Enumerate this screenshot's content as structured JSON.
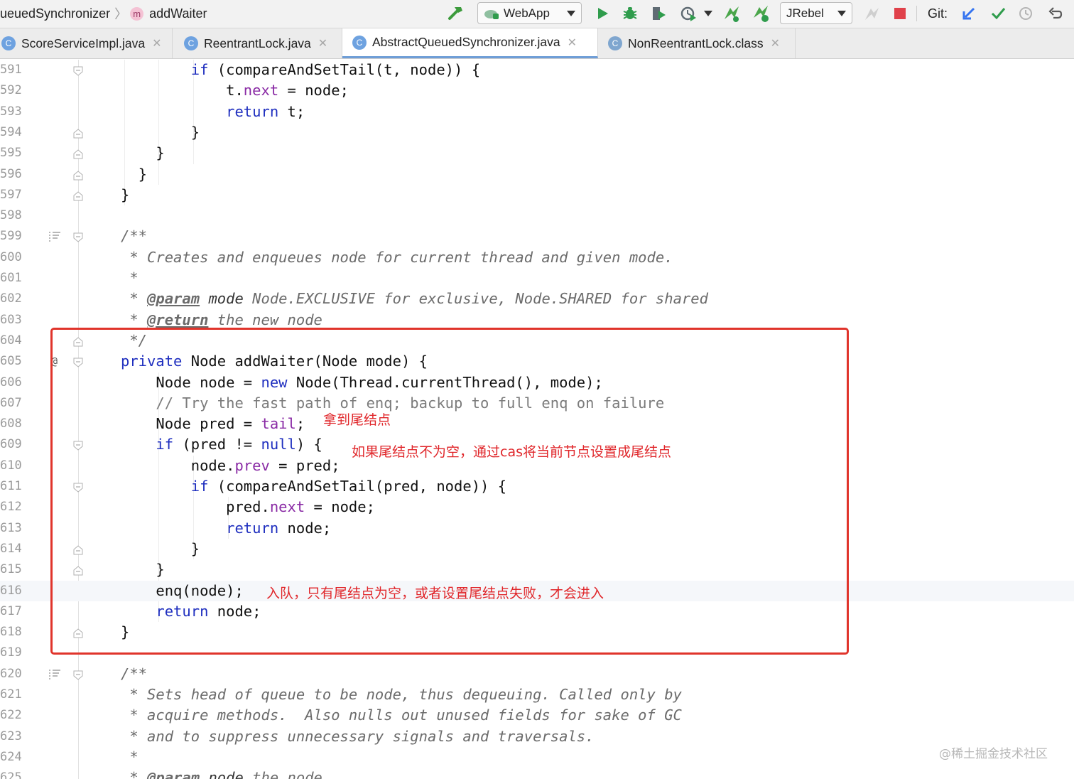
{
  "breadcrumb": {
    "class_name": "ueuedSynchronizer",
    "separator": "〉",
    "method_badge": "m",
    "method_name": "addWaiter"
  },
  "toolbar": {
    "run_config": "WebApp",
    "jrebel_config": "JRebel",
    "git_label": "Git:"
  },
  "tabs": [
    {
      "label": "ScoreServiceImpl.java",
      "badge": "C",
      "active": false
    },
    {
      "label": "ReentrantLock.java",
      "badge": "C",
      "active": false
    },
    {
      "label": "AbstractQueuedSynchronizer.java",
      "badge": "C",
      "active": true
    },
    {
      "label": "NonReentrantLock.class",
      "badge": "C",
      "active": false
    }
  ],
  "editor": {
    "gutter_marker_605": "@",
    "lines": [
      {
        "n": "591",
        "tokens": [
          [
            "",
            "        "
          ],
          [
            "kw",
            "if"
          ],
          [
            "",
            " (compareAndSetTail(t, node)) {"
          ]
        ]
      },
      {
        "n": "592",
        "tokens": [
          [
            "",
            "            t."
          ],
          [
            "fld",
            "next"
          ],
          [
            "",
            " = node;"
          ]
        ]
      },
      {
        "n": "593",
        "tokens": [
          [
            "",
            "            "
          ],
          [
            "kw",
            "return"
          ],
          [
            "",
            " t;"
          ]
        ]
      },
      {
        "n": "594",
        "tokens": [
          [
            "",
            "        }"
          ]
        ]
      },
      {
        "n": "595",
        "tokens": [
          [
            "",
            "    }"
          ]
        ]
      },
      {
        "n": "596",
        "tokens": [
          [
            "",
            "  }"
          ]
        ]
      },
      {
        "n": "597",
        "tokens": [
          [
            "",
            "}"
          ]
        ]
      },
      {
        "n": "598",
        "tokens": []
      },
      {
        "n": "599",
        "tokens": [
          [
            "doc",
            "/**"
          ]
        ]
      },
      {
        "n": "600",
        "tokens": [
          [
            "doc",
            " * Creates and enqueues node for current thread and given mode."
          ]
        ]
      },
      {
        "n": "601",
        "tokens": [
          [
            "doc",
            " *"
          ]
        ]
      },
      {
        "n": "602",
        "tokens": [
          [
            "doc",
            " * "
          ],
          [
            "tag",
            "@param"
          ],
          [
            "doc",
            " "
          ],
          [
            "docb",
            "mode"
          ],
          [
            "doc",
            " Node.EXCLUSIVE for exclusive, Node.SHARED for shared"
          ]
        ]
      },
      {
        "n": "603",
        "tokens": [
          [
            "doc",
            " * "
          ],
          [
            "tag",
            "@return"
          ],
          [
            "doc",
            " the new node"
          ]
        ]
      },
      {
        "n": "604",
        "tokens": [
          [
            "doc",
            " */"
          ]
        ]
      },
      {
        "n": "605",
        "tokens": [
          [
            "kw",
            "private"
          ],
          [
            "",
            " Node addWaiter(Node mode) {"
          ]
        ]
      },
      {
        "n": "606",
        "tokens": [
          [
            "",
            "    Node node = "
          ],
          [
            "kw",
            "new"
          ],
          [
            "",
            " Node(Thread.currentThread(), mode);"
          ]
        ]
      },
      {
        "n": "607",
        "tokens": [
          [
            "cm",
            "    // Try the fast path of enq; backup to full enq on failure"
          ]
        ]
      },
      {
        "n": "608",
        "tokens": [
          [
            "",
            "    Node pred = "
          ],
          [
            "fld",
            "tail"
          ],
          [
            "",
            ";"
          ]
        ]
      },
      {
        "n": "609",
        "tokens": [
          [
            "",
            "    "
          ],
          [
            "kw",
            "if"
          ],
          [
            "",
            " (pred != "
          ],
          [
            "kw",
            "null"
          ],
          [
            "",
            ") {"
          ]
        ]
      },
      {
        "n": "610",
        "tokens": [
          [
            "",
            "        node."
          ],
          [
            "fld",
            "prev"
          ],
          [
            "",
            " = pred;"
          ]
        ]
      },
      {
        "n": "611",
        "tokens": [
          [
            "",
            "        "
          ],
          [
            "kw",
            "if"
          ],
          [
            "",
            " (compareAndSetTail(pred, node)) {"
          ]
        ]
      },
      {
        "n": "612",
        "tokens": [
          [
            "",
            "            pred."
          ],
          [
            "fld",
            "next"
          ],
          [
            "",
            " = node;"
          ]
        ]
      },
      {
        "n": "613",
        "tokens": [
          [
            "",
            "            "
          ],
          [
            "kw",
            "return"
          ],
          [
            "",
            " node;"
          ]
        ]
      },
      {
        "n": "614",
        "tokens": [
          [
            "",
            "        }"
          ]
        ]
      },
      {
        "n": "615",
        "tokens": [
          [
            "",
            "    }"
          ]
        ]
      },
      {
        "n": "616",
        "tokens": [
          [
            "",
            "    enq(node);"
          ]
        ]
      },
      {
        "n": "617",
        "tokens": [
          [
            "",
            "    "
          ],
          [
            "kw",
            "return"
          ],
          [
            "",
            " node;"
          ]
        ]
      },
      {
        "n": "618",
        "tokens": [
          [
            "",
            "}"
          ]
        ]
      },
      {
        "n": "619",
        "tokens": []
      },
      {
        "n": "620",
        "tokens": [
          [
            "doc",
            "/**"
          ]
        ]
      },
      {
        "n": "621",
        "tokens": [
          [
            "doc",
            " * Sets head of queue to be node, thus dequeuing. Called only by"
          ]
        ]
      },
      {
        "n": "622",
        "tokens": [
          [
            "doc",
            " * acquire methods.  Also nulls out unused fields for sake of GC"
          ]
        ]
      },
      {
        "n": "623",
        "tokens": [
          [
            "doc",
            " * and to suppress unnecessary signals and traversals."
          ]
        ]
      },
      {
        "n": "624",
        "tokens": [
          [
            "doc",
            " *"
          ]
        ]
      },
      {
        "n": "625",
        "tokens": [
          [
            "doc",
            " * "
          ],
          [
            "tag",
            "@param"
          ],
          [
            "doc",
            " "
          ],
          [
            "docb",
            "node"
          ],
          [
            "doc",
            " the node"
          ]
        ]
      }
    ]
  },
  "annotations": {
    "tail": "拿到尾结点",
    "cas": "如果尾结点不为空，通过cas将当前节点设置成尾结点",
    "enq": "入队，只有尾结点为空，或者设置尾结点失败，才会进入"
  },
  "watermark": "@稀土掘金技术社区",
  "colors": {
    "keyword": "#1f2fbf",
    "field": "#8a2ba5",
    "comment": "#7b7b7b",
    "annotation": "#e0262a",
    "tab_badge": "#6ea2e0"
  }
}
